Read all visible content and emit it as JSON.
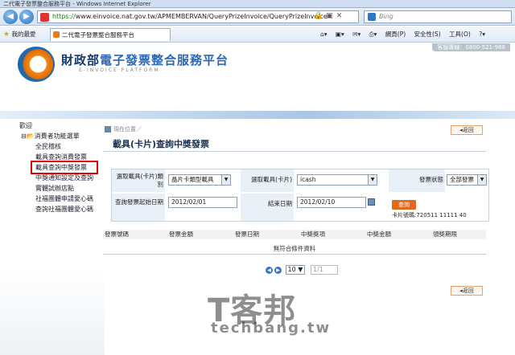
{
  "browser": {
    "title": "二代電子發票整合服務平台 - Windows Internet Explorer",
    "url_scheme": "https://",
    "url_rest": "www.einvoice.nat.gov.tw/APMEMBERVAN/QueryPrizeInvoice/QueryPrizeInvoice",
    "search_placeholder": "Bing",
    "favorites_label": "我的最愛",
    "tab_title": "二代電子發票整合服務平台",
    "commands": {
      "page": "網頁(P)",
      "safety": "安全性(S)",
      "tools": "工具(O)"
    }
  },
  "header": {
    "hotline": "客服專線：0800-521-988",
    "brand_dept": "財政部",
    "brand_service": "電子發票整合服務平台",
    "brand_sub": "E-INVOICE PLATFORM"
  },
  "sidebar": {
    "root": "歡迎",
    "group": "消費者功能選單",
    "items": [
      {
        "label": "全民稽核"
      },
      {
        "label": "載具查詢消費發票"
      },
      {
        "label": "載具查詢中獎發票"
      },
      {
        "label": "中獎通知設定及查詢"
      },
      {
        "label": "實體試辦店點"
      },
      {
        "label": "社福團體申請愛心碼"
      },
      {
        "label": "查詢社福團體愛心碼"
      }
    ]
  },
  "breadcrumb": "現在位置／",
  "back_label": "返回",
  "page_title": "載具(卡片)查詢中獎發票",
  "form": {
    "carrier_type_label": "選取載具(卡片)類別",
    "carrier_type_value": "晶片卡類型載具",
    "carrier_label": "選取載具(卡片)",
    "carrier_value": "icash",
    "status_label": "發票狀態",
    "status_value": "全部發票",
    "start_label": "查詢發票起始日期",
    "start_value": "2012/02/01",
    "end_label": "結束日期",
    "end_value": "2012/02/10",
    "query_label": "查詢",
    "card_no": "卡片號碼:720511 11111 40"
  },
  "table": {
    "headers": [
      "發票號碼",
      "發票金額",
      "發票日期",
      "中獎獎項",
      "中獎金額",
      "領獎期限"
    ],
    "empty_text": "無符合條件資料"
  },
  "pager": {
    "page_size": "10",
    "page_input": "1/1"
  },
  "watermark": {
    "main": "T客邦",
    "sub": "techbang.tw"
  }
}
